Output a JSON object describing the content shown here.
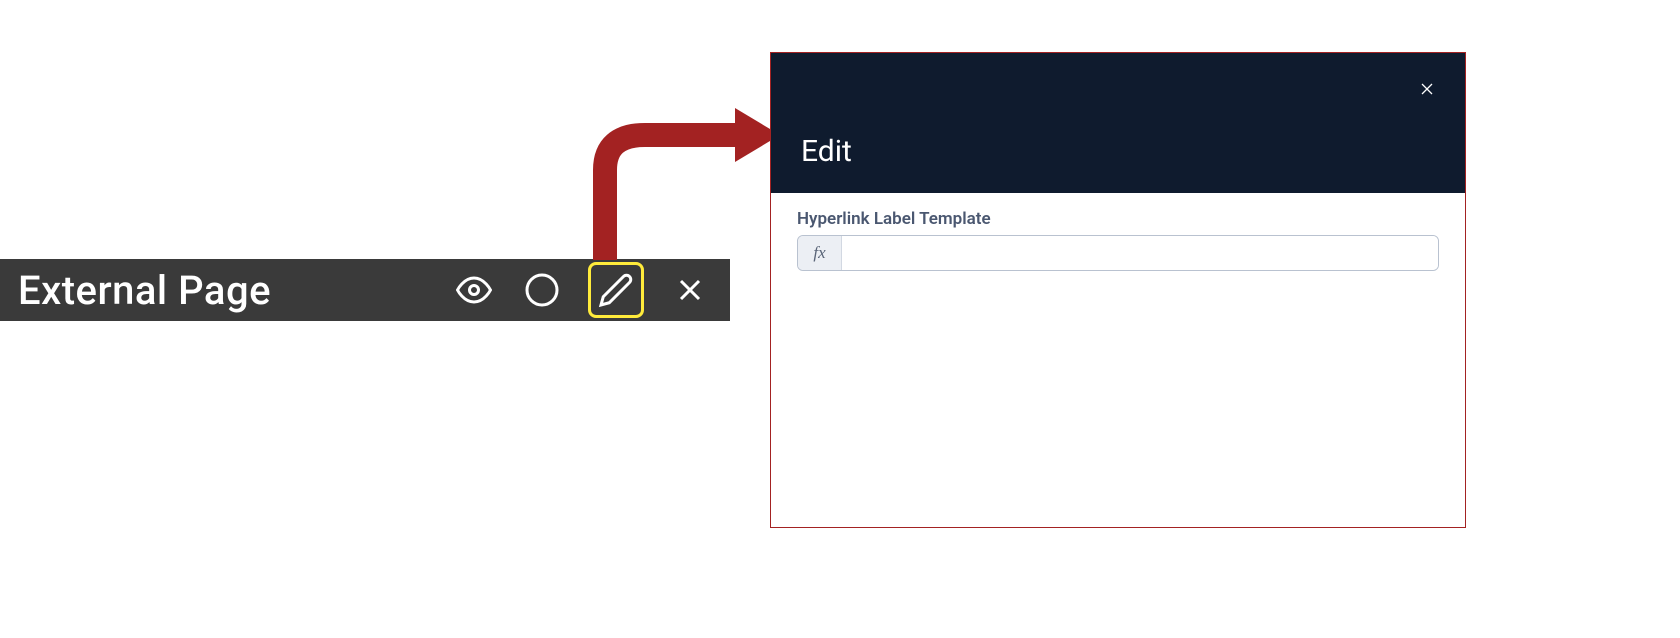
{
  "toolbar": {
    "title": "External Page",
    "icons": {
      "view": "eye-icon",
      "circle": "circle-icon",
      "edit": "pencil-icon",
      "close": "close-icon"
    }
  },
  "panel": {
    "title": "Edit",
    "field_label": "Hyperlink Label Template",
    "fx_prefix": "fx",
    "input_value": ""
  }
}
